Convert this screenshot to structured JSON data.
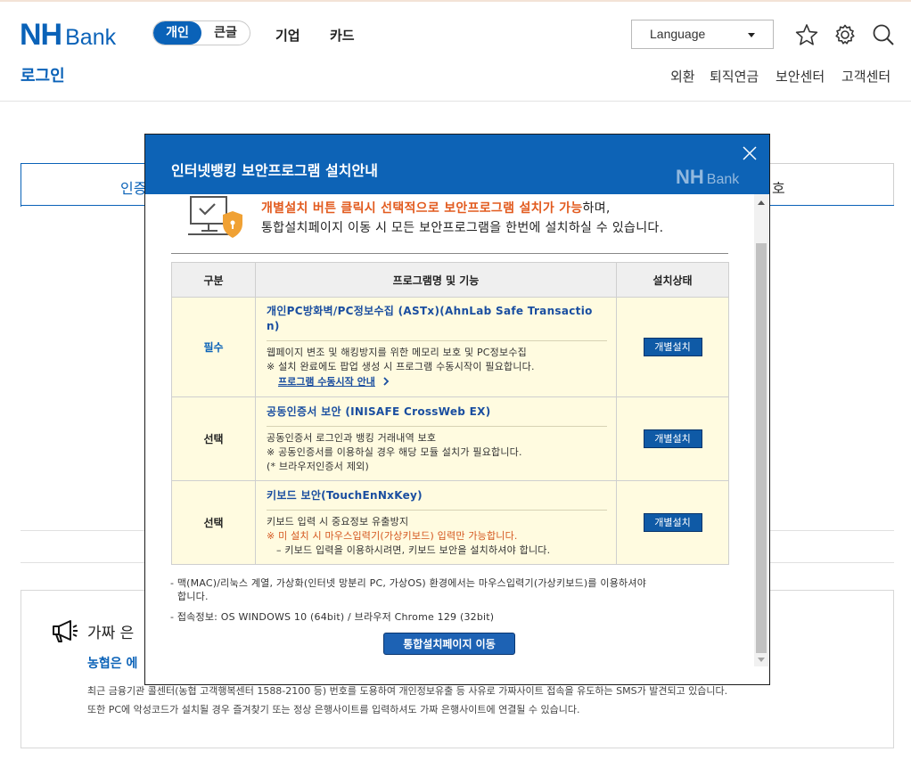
{
  "header": {
    "logo_nh": "NH",
    "logo_bank": "Bank",
    "segment": {
      "personal": "개인",
      "large": "큰글"
    },
    "nav": [
      "기업",
      "카드"
    ],
    "language": "Language",
    "page_title": "로그인",
    "util_links": [
      "외환",
      "퇴직연금",
      "보안센터",
      "고객센터"
    ]
  },
  "background": {
    "tab_left": "인증",
    "tab_right": "호",
    "notice_title": "가짜 은",
    "notice_sub": "농협은 에",
    "notice_p1": "최근 금융기관 콜센터(농협 고객행복센터 1588-2100 등) 번호를 도용하여 개인정보유출 등 사유로 가짜사이트 접속을 유도하는 SMS가 발견되고 있습니다.",
    "notice_p2": "또한 PC에 악성코드가 설치될 경우 즐겨찾기 또는 정상 은행사이트를 입력하셔도 가짜 은행사이트에 연결될 수 있습니다."
  },
  "popup": {
    "title": "인터넷뱅킹 보안프로그램 설치안내",
    "logo_nh": "NH",
    "logo_bank": "Bank",
    "intro_red": "개별설치 버튼 클릭시 선택적으로 보안프로그램 설치가 가능",
    "intro_rest": "하며,",
    "intro2": "통합설치페이지 이동 시 모든 보안프로그램을 한번에 설치하실 수 있습니다.",
    "columns": [
      "구분",
      "프로그램명 및 기능",
      "설치상태"
    ],
    "rows": [
      {
        "category": "필수",
        "name": "개인PC방화벽/PC정보수집 (ASTx)(AhnLab Safe Transaction)",
        "name_line1": "개인PC방화벽/PC정보수집 (ASTx)(AhnLab Safe Transactio",
        "name_line2": "n)",
        "lines": [
          "웹페이지 변조 및 해킹방지를 위한 메모리 보호 및 PC정보수집",
          "※ 설치 완료에도 팝업 생성 시 프로그램 수동시작이 필요합니다."
        ],
        "link": "프로그램 수동시작 안내",
        "button": "개별설치"
      },
      {
        "category": "선택",
        "name": "공동인증서 보안 (INISAFE CrossWeb EX)",
        "lines": [
          "공동인증서 로그인과 뱅킹 거래내역 보호",
          "※ 공동인증서를 이용하실 경우 해당 모듈 설치가 필요합니다.",
          "(* 브라우저인증서 제외)"
        ],
        "button": "개별설치"
      },
      {
        "category": "선택",
        "name": "키보드 보안(TouchEnNxKey)",
        "lines": [
          "키보드 입력 시 중요정보 유출방지"
        ],
        "warn": "※ 미 설치 시 마우스입력기(가상키보드) 입력만 가능합니다.",
        "sub": "– 키보드 입력을 이용하시려면, 키보드 보안을 설치하셔야 합니다.",
        "button": "개별설치"
      }
    ],
    "note1a": "- 맥(MAC)/리눅스 계열, 가상화(인터넷 망분리 PC, 가상OS) 환경에서는 마우스입력기(가상키보드)를 이용하셔야",
    "note1b": "합니다.",
    "note2": "- 접속정보: OS WINDOWS 10 (64bit) / 브라우저 Chrome 129 (32bit)",
    "go_button": "통합설치페이지 이동"
  },
  "colors": {
    "brand_blue": "#0a62b8",
    "popup_header": "#0d63b6",
    "highlight_red": "#e25b1f",
    "row_bg": "#fffbe0"
  },
  "icons": [
    "star-icon",
    "gear-icon",
    "search-icon",
    "close-icon",
    "security-pc-icon",
    "megaphone-icon"
  ]
}
